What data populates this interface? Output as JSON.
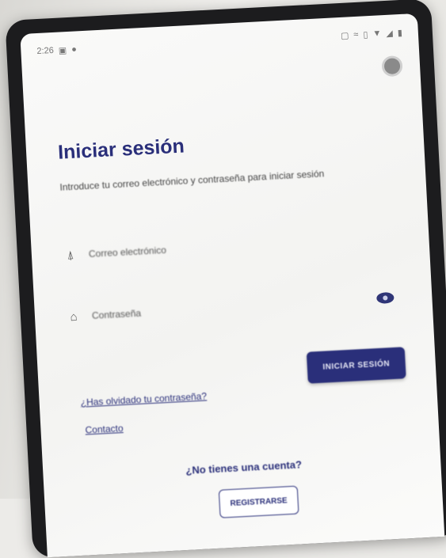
{
  "status_bar": {
    "time": "2:26",
    "left_icons": [
      "notification-icon",
      "record-icon"
    ],
    "right_icons": [
      "cast-icon",
      "nfc-icon",
      "vibrate-icon",
      "wifi-icon",
      "signal-icon",
      "battery-icon"
    ]
  },
  "login": {
    "title": "Iniciar sesión",
    "subtitle": "Introduce tu correo electrónico y contraseña para iniciar sesión",
    "email_placeholder": "Correo electrónico",
    "password_placeholder": "Contraseña",
    "login_button": "INICIAR SESIÓN",
    "forgot_password": "¿Has olvidado tu contraseña?",
    "contact": "Contacto",
    "no_account": "¿No tienes una cuenta?",
    "register_button": "REGISTRARSE"
  },
  "colors": {
    "accent": "#2a2f7a",
    "background": "#f5f5f3"
  }
}
